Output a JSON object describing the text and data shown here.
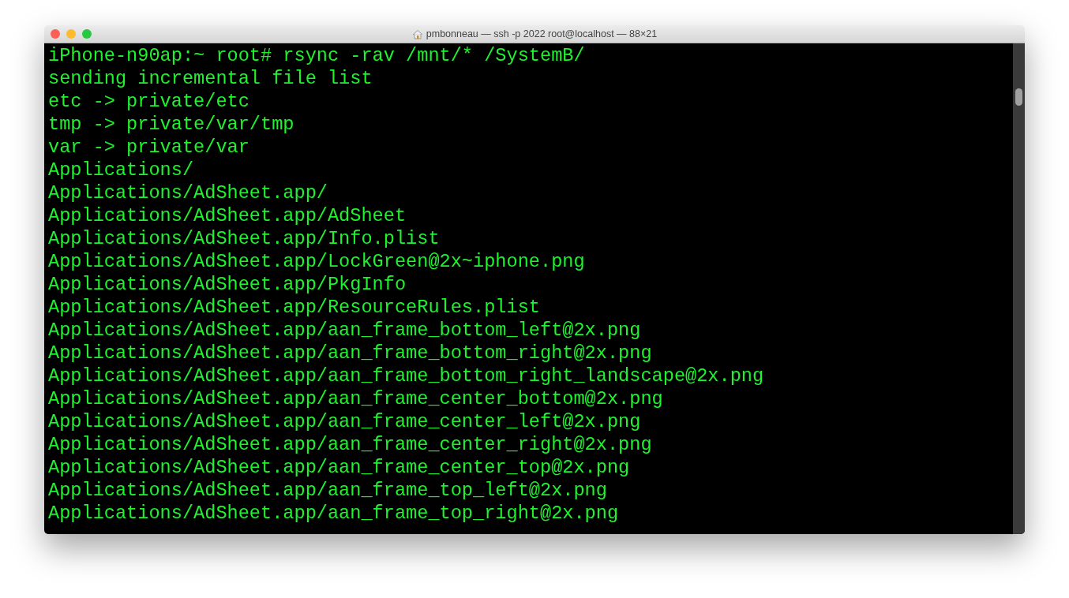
{
  "window": {
    "title": "pmbonneau — ssh -p 2022 root@localhost — 88×21"
  },
  "terminal": {
    "lines": [
      "iPhone-n90ap:~ root# rsync -rav /mnt/* /SystemB/",
      "sending incremental file list",
      "etc -> private/etc",
      "tmp -> private/var/tmp",
      "var -> private/var",
      "Applications/",
      "Applications/AdSheet.app/",
      "Applications/AdSheet.app/AdSheet",
      "Applications/AdSheet.app/Info.plist",
      "Applications/AdSheet.app/LockGreen@2x~iphone.png",
      "Applications/AdSheet.app/PkgInfo",
      "Applications/AdSheet.app/ResourceRules.plist",
      "Applications/AdSheet.app/aan_frame_bottom_left@2x.png",
      "Applications/AdSheet.app/aan_frame_bottom_right@2x.png",
      "Applications/AdSheet.app/aan_frame_bottom_right_landscape@2x.png",
      "Applications/AdSheet.app/aan_frame_center_bottom@2x.png",
      "Applications/AdSheet.app/aan_frame_center_left@2x.png",
      "Applications/AdSheet.app/aan_frame_center_right@2x.png",
      "Applications/AdSheet.app/aan_frame_center_top@2x.png",
      "Applications/AdSheet.app/aan_frame_top_left@2x.png",
      "Applications/AdSheet.app/aan_frame_top_right@2x.png"
    ]
  }
}
